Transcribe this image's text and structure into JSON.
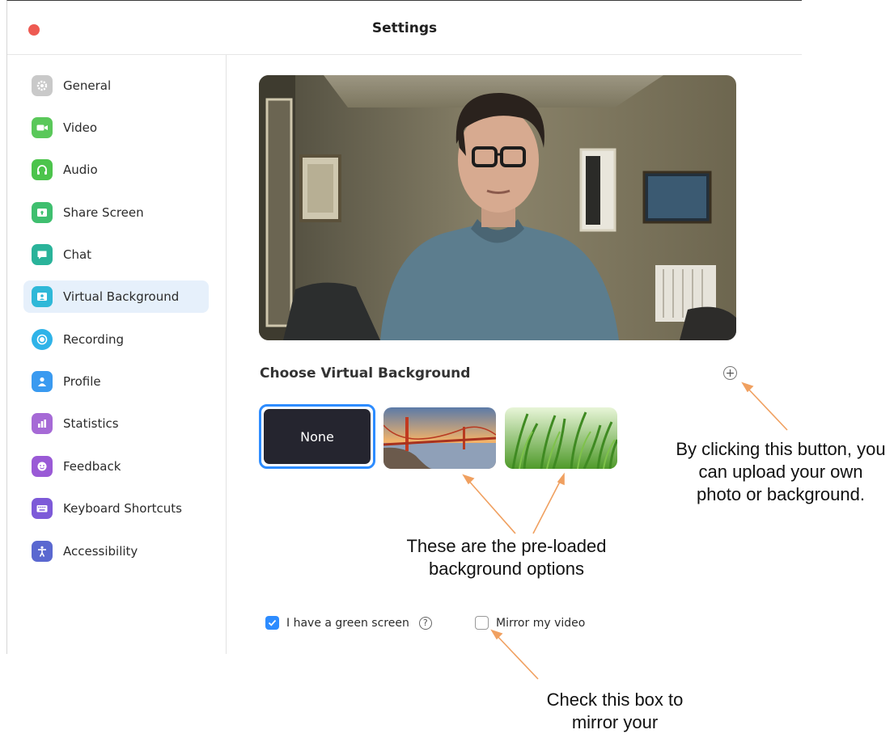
{
  "window": {
    "title": "Settings"
  },
  "sidebar": {
    "items": [
      {
        "label": "General",
        "icon": "gear-icon",
        "color": "#c9c9c9",
        "active": false
      },
      {
        "label": "Video",
        "icon": "video-camera-icon",
        "color": "#5ac85a",
        "active": false
      },
      {
        "label": "Audio",
        "icon": "headphones-icon",
        "color": "#4cc44c",
        "active": false
      },
      {
        "label": "Share Screen",
        "icon": "share-screen-icon",
        "color": "#3fbf6f",
        "active": false
      },
      {
        "label": "Chat",
        "icon": "chat-bubble-icon",
        "color": "#2ab39a",
        "active": false
      },
      {
        "label": "Virtual Background",
        "icon": "person-frame-icon",
        "color": "#2fb8d8",
        "active": true
      },
      {
        "label": "Recording",
        "icon": "record-icon",
        "color": "#2fb3e8",
        "active": false
      },
      {
        "label": "Profile",
        "icon": "person-icon",
        "color": "#3a9af0",
        "active": false
      },
      {
        "label": "Statistics",
        "icon": "bar-chart-icon",
        "color": "#a66ad6",
        "active": false
      },
      {
        "label": "Feedback",
        "icon": "smiley-icon",
        "color": "#9a5ad6",
        "active": false
      },
      {
        "label": "Keyboard Shortcuts",
        "icon": "keyboard-icon",
        "color": "#7d5ad8",
        "active": false
      },
      {
        "label": "Accessibility",
        "icon": "accessibility-icon",
        "color": "#5a68d0",
        "active": false
      }
    ]
  },
  "main": {
    "section_title": "Choose Virtual Background",
    "add_button_symbol": "+",
    "backgrounds": [
      {
        "label": "None",
        "selected": true
      },
      {
        "label": "",
        "icon": "golden-gate-bridge-thumbnail",
        "selected": false
      },
      {
        "label": "",
        "icon": "grass-thumbnail",
        "selected": false
      }
    ],
    "green_screen": {
      "label": "I have a green screen",
      "checked": true,
      "help_symbol": "?"
    },
    "mirror": {
      "label": "Mirror my video",
      "checked": false
    }
  },
  "annotations": {
    "upload": "By clicking this button, you can upload your own photo or background.",
    "preloaded": "These are the pre-loaded background options",
    "mirror": "Check this box to mirror your"
  },
  "colors": {
    "accent": "#2d8cff",
    "arrow": "#f0a060",
    "close": "#ee5a52",
    "active_nav": "#e6f0fb"
  }
}
